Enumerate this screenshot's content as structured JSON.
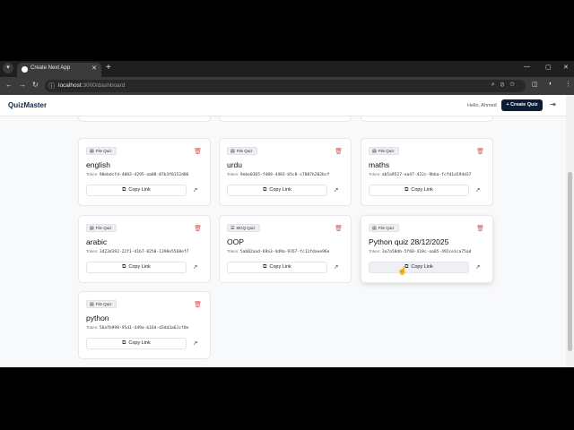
{
  "browser": {
    "tab_title": "Create Next App",
    "url_host": "localhost",
    "url_path": ":3000/dashboard"
  },
  "app": {
    "logo": "QuizMaster",
    "greeting": "Hello, Ahmed",
    "create_button": "Create Quiz"
  },
  "labels": {
    "token_prefix": "Token:",
    "copy_link": "Copy Link"
  },
  "quizzes": [
    {
      "type": "File Quiz",
      "title": "english",
      "token": "90ebdcfd-4083-4295-aa88-07b3f0152d06"
    },
    {
      "type": "File Quiz",
      "title": "urdu",
      "token": "9ebe0365-f489-4483-b5c8-c7087b202bcf"
    },
    {
      "type": "File Quiz",
      "title": "maths",
      "token": "ab5a9527-ea47-422c-9bba-fcfd1a594d37"
    },
    {
      "type": "File Quiz",
      "title": "arabic",
      "token": "3423d392-22f1-41b7-8250-1398e5568ef7"
    },
    {
      "type": "MCQ Quiz",
      "title": "OOP",
      "token": "5ab02aad-69a3-4d9a-9767-fc11fdaee96e"
    },
    {
      "type": "File Quiz",
      "title": "Python quiz 28/12/2025",
      "token": "3a7a58db-5f60-418c-aa05-492ce1ca75ad"
    },
    {
      "type": "File Quiz",
      "title": "python",
      "token": "56afb998-95d1-449a-b16d-d3dd3a61cf0e"
    }
  ],
  "colors": {
    "header_button_bg": "#0b1c34",
    "logo_color": "#0f2a4a",
    "delete_icon": "#d9534f",
    "page_bg": "#f8f9fb"
  }
}
